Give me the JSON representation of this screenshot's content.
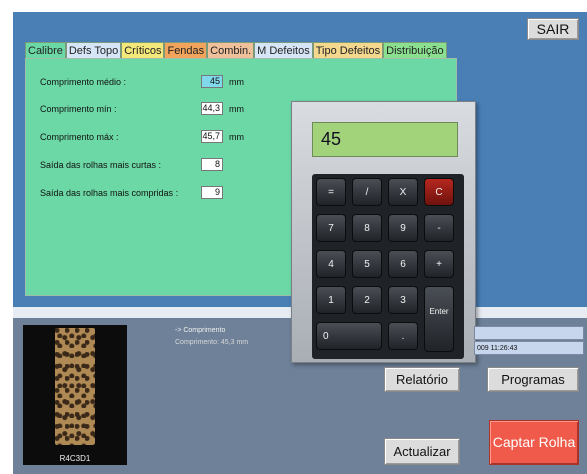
{
  "header": {
    "exit_button": "SAIR"
  },
  "tabs": [
    "Calibre",
    "Defs Topo",
    "Críticos",
    "Fendas",
    "Combin.",
    "M Defeitos",
    "Tipo Defeitos",
    "Distribuição"
  ],
  "active_tab": "Calibre",
  "fields": [
    {
      "label": "Comprimento médio :",
      "value": "45",
      "unit": "mm"
    },
    {
      "label": "Comprimento mín :",
      "value": "44,3",
      "unit": "mm"
    },
    {
      "label": "Comprimento máx :",
      "value": "45,7",
      "unit": "mm"
    },
    {
      "label": "Saída das rolhas mais curtas :",
      "value": "8",
      "unit": ""
    },
    {
      "label": "Saída das rolhas mais compridas :",
      "value": "9",
      "unit": ""
    }
  ],
  "calculator": {
    "display": "45",
    "keys": [
      "=",
      "/",
      "X",
      "C",
      "7",
      "8",
      "9",
      "-",
      "4",
      "5",
      "6",
      "+",
      "1",
      "2",
      "3",
      "Enter",
      "0",
      "."
    ]
  },
  "bottom": {
    "image_caption": "R4C3D1",
    "info_title": "-> Comprimento",
    "info_line": "Comprimento: 45,3 mm",
    "timestamp": "009 11:26:43",
    "buttons": {
      "relatorio": "Relatório",
      "programas": "Programas",
      "actualizar": "Actualizar",
      "captar": "Captar Rolha"
    }
  },
  "colors": {
    "panel_blue": "#4a7fb6",
    "tab_green": "#6cd8a6",
    "display_green": "#a2d37a",
    "capture_red": "#f05a4a"
  }
}
